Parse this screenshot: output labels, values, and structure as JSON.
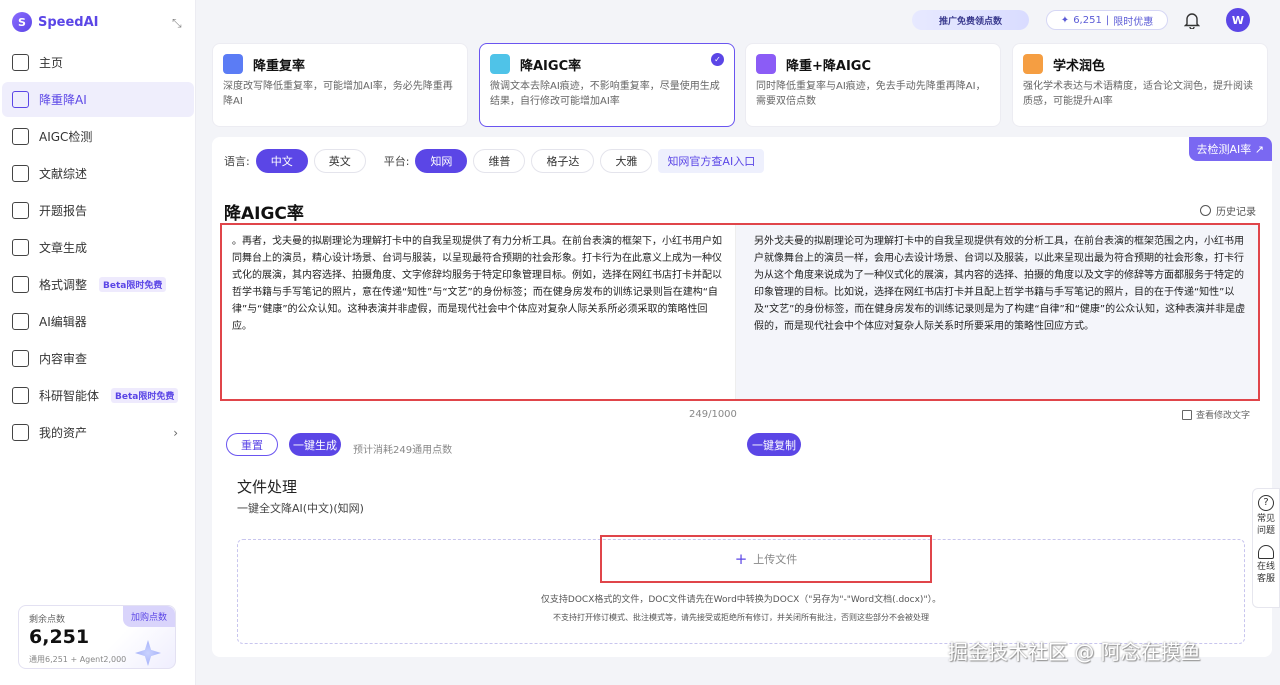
{
  "app": {
    "name": "SpeedAI",
    "logo_letter": "S"
  },
  "sidebar": {
    "items": [
      {
        "label": "主页",
        "badge": ""
      },
      {
        "label": "降重降AI",
        "badge": ""
      },
      {
        "label": "AIGC检测",
        "badge": ""
      },
      {
        "label": "文献综述",
        "badge": ""
      },
      {
        "label": "开题报告",
        "badge": ""
      },
      {
        "label": "文章生成",
        "badge": ""
      },
      {
        "label": "格式调整",
        "badge": "Beta限时免费"
      },
      {
        "label": "AI编辑器",
        "badge": ""
      },
      {
        "label": "内容审查",
        "badge": ""
      },
      {
        "label": "科研智能体",
        "badge": "Beta限时免费"
      },
      {
        "label": "我的资产",
        "badge": ""
      }
    ],
    "chevron": "›",
    "points": {
      "label": "剩余点数",
      "value": "6,251",
      "sub": "通用6,251 + Agent2,000",
      "buy": "加购点数"
    }
  },
  "topbar": {
    "promo": "推广免费领点数",
    "credits": "6,251",
    "credit_sep": "|",
    "limited": "限时优惠",
    "avatar": "W"
  },
  "modes": [
    {
      "title": "降重复率",
      "desc": "深度改写降低重复率，可能增加AI率，务必先降重再降AI",
      "color": "#5b7cf5"
    },
    {
      "title": "降AIGC率",
      "desc": "微调文本去除AI痕迹，不影响重复率，尽量使用生成结果，自行修改可能增加AI率",
      "color": "#4fc3e8"
    },
    {
      "title": "降重+降AIGC",
      "desc": "同时降低重复率与AI痕迹，免去手动先降重再降AI，需要双倍点数",
      "color": "#8b5cf6"
    },
    {
      "title": "学术润色",
      "desc": "强化学术表达与术语精度，适合论文润色，提升阅读质感，可能提升AI率",
      "color": "#f59e42"
    }
  ],
  "options": {
    "lang_label": "语言:",
    "langs": [
      "中文",
      "英文"
    ],
    "platform_label": "平台:",
    "platforms": [
      "知网",
      "维普",
      "格子达",
      "大雅"
    ],
    "link": "知网官方查AI入口",
    "detect": "去检测AI率 ↗"
  },
  "editor": {
    "title": "降AIGC率",
    "history": "历史记录",
    "input": "。再者，戈夫曼的拟剧理论为理解打卡中的自我呈现提供了有力分析工具。在前台表演的框架下，小红书用户如同舞台上的演员，精心设计场景、台词与服装，以呈现最符合预期的社会形象。打卡行为在此意义上成为一种仪式化的展演，其内容选择、拍摄角度、文字修辞均服务于特定印象管理目标。例如，选择在网红书店打卡并配以哲学书籍与手写笔记的照片，意在传递“知性”与“文艺”的身份标签；而在健身房发布的训练记录则旨在建构“自律”与“健康”的公众认知。这种表演并非虚假，而是现代社会中个体应对复杂人际关系所必须采取的策略性回应。",
    "output": "另外戈夫曼的拟剧理论可为理解打卡中的自我呈现提供有效的分析工具，在前台表演的框架范围之内，小红书用户就像舞台上的演员一样，会用心去设计场景、台词以及服装，以此来呈现出最为符合预期的社会形象，打卡行为从这个角度来说成为了一种仪式化的展演，其内容的选择、拍摄的角度以及文字的修辞等方面都服务于特定的印象管理的目标。比如说，选择在网红书店打卡并且配上哲学书籍与手写笔记的照片，目的在于传递“知性”以及“文艺”的身份标签，而在健身房发布的训练记录则是为了构建“自律”和“健康”的公众认知，这种表演并非是虚假的，而是现代社会中个体应对复杂人际关系时所要采用的策略性回应方式。",
    "counter": "249/1000",
    "view_changes": "查看修改文字",
    "reset": "重置",
    "generate": "一键生成",
    "cost": "预计消耗249通用点数",
    "copy": "一键复制"
  },
  "file": {
    "title": "文件处理",
    "subtitle": "一键全文降AI(中文)(知网)",
    "upload": "上传文件",
    "hint1": "仅支持DOCX格式的文件，DOC文件请先在Word中转换为DOCX（\"另存为\"-\"Word文档(.docx)\"）。",
    "hint2": "不支持打开修订模式、批注模式等，请先接受或拒绝所有修订，并关闭所有批注，否则这些部分不会被处理"
  },
  "help": {
    "faq": "常见问题",
    "service": "在线客服"
  },
  "watermark": "掘金技术社区 @ 阿念在摸鱼"
}
